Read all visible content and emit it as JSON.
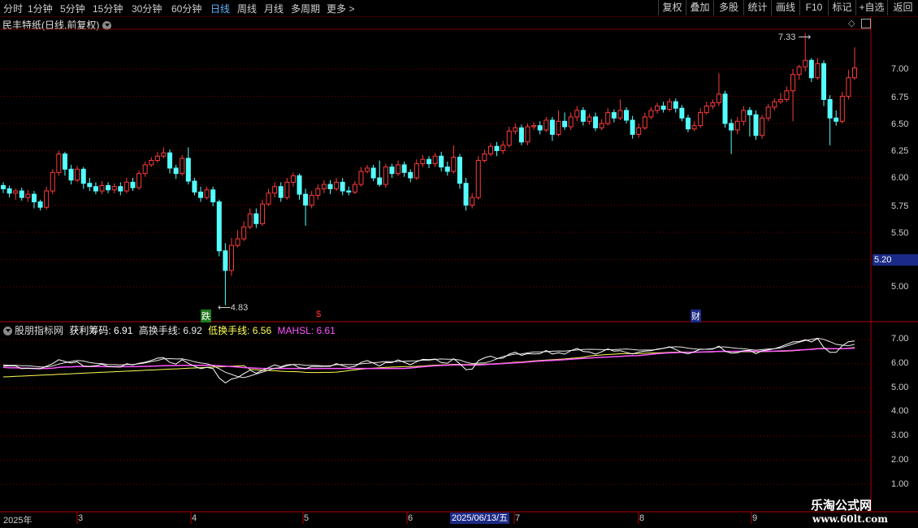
{
  "toolbar": {
    "periods": [
      "分时",
      "1分钟",
      "5分钟",
      "15分钟",
      "30分钟",
      "60分钟",
      "日线",
      "周线",
      "月线",
      "多周期",
      "更多"
    ],
    "active_period": "日线",
    "right_buttons": [
      "复权",
      "叠加",
      "多股",
      "统计",
      "画线",
      "F10",
      "标记",
      "+自选",
      "返回"
    ]
  },
  "chart_title": "民丰特纸(日线,前复权)",
  "main_axis": {
    "ticks": [
      "7.00",
      "6.75",
      "6.50",
      "6.25",
      "6.00",
      "5.75",
      "5.50",
      "5.00"
    ],
    "current_price": "5.20"
  },
  "annotations": {
    "high": "7.33",
    "low": "4.83"
  },
  "markers": [
    "跌",
    "$",
    "财"
  ],
  "indicator": {
    "name": "股朋指标网",
    "profit_label": "获利筹码: 6.91",
    "high_label": "高换手线: 6.92",
    "low_label": "低换手线: 6.56",
    "mahsl_label": "MAHSL: 6.61",
    "ticks": [
      "7.00",
      "6.00",
      "5.00",
      "4.00",
      "3.00",
      "2.00",
      "1.00"
    ]
  },
  "x_axis": {
    "labels": [
      "2025年",
      "3",
      "4",
      "5",
      "6",
      "7",
      "8",
      "9"
    ],
    "cursor_date": "2025/06/13/五"
  },
  "watermark": {
    "title": "乐淘公式网",
    "url": "www.60lt.com"
  },
  "colors": {
    "up": "#ff3b3b",
    "down": "#54ffff",
    "grid": "#7a0000",
    "profit_line": "#ffffff",
    "high_line": "#e8e8e8",
    "low_line": "#ffff55",
    "mahsl_line": "#ff55ff"
  },
  "chart_data": {
    "type": "candlestick",
    "price_axis": {
      "min": 4.75,
      "max": 7.35
    },
    "candles": [
      [
        5.93,
        5.9,
        5.96,
        5.86
      ],
      [
        5.9,
        5.86,
        5.93,
        5.82
      ],
      [
        5.86,
        5.88,
        5.9,
        5.8
      ],
      [
        5.88,
        5.82,
        5.91,
        5.79
      ],
      [
        5.82,
        5.85,
        5.89,
        5.78
      ],
      [
        5.85,
        5.78,
        5.88,
        5.72
      ],
      [
        5.78,
        5.73,
        5.8,
        5.7
      ],
      [
        5.73,
        5.88,
        5.92,
        5.71
      ],
      [
        5.88,
        6.05,
        6.08,
        5.85
      ],
      [
        6.05,
        6.22,
        6.25,
        6.02
      ],
      [
        6.22,
        6.08,
        6.24,
        6.02
      ],
      [
        6.08,
        5.98,
        6.12,
        5.94
      ],
      [
        5.98,
        6.08,
        6.11,
        5.96
      ],
      [
        6.08,
        5.95,
        6.1,
        5.9
      ],
      [
        5.95,
        5.92,
        6.0,
        5.88
      ],
      [
        5.92,
        5.88,
        5.96,
        5.85
      ],
      [
        5.88,
        5.93,
        5.97,
        5.85
      ],
      [
        5.93,
        5.89,
        5.96,
        5.86
      ],
      [
        5.89,
        5.92,
        5.95,
        5.86
      ],
      [
        5.92,
        5.88,
        5.96,
        5.84
      ],
      [
        5.88,
        5.96,
        6.0,
        5.86
      ],
      [
        5.96,
        5.91,
        6.0,
        5.88
      ],
      [
        5.91,
        6.04,
        6.07,
        5.89
      ],
      [
        6.04,
        6.12,
        6.15,
        6.01
      ],
      [
        6.12,
        6.16,
        6.19,
        6.1
      ],
      [
        6.16,
        6.2,
        6.24,
        6.14
      ],
      [
        6.2,
        6.23,
        6.28,
        6.18
      ],
      [
        6.23,
        6.09,
        6.26,
        6.04
      ],
      [
        6.09,
        6.04,
        6.12,
        5.99
      ],
      [
        6.04,
        6.18,
        6.21,
        6.02
      ],
      [
        6.18,
        5.97,
        6.28,
        5.94
      ],
      [
        5.97,
        5.87,
        6.0,
        5.84
      ],
      [
        5.87,
        5.82,
        5.92,
        5.78
      ],
      [
        5.82,
        5.89,
        5.92,
        5.8
      ],
      [
        5.89,
        5.78,
        5.92,
        5.74
      ],
      [
        5.78,
        5.33,
        5.8,
        5.28
      ],
      [
        5.33,
        5.15,
        5.4,
        4.83
      ],
      [
        5.15,
        5.38,
        5.45,
        5.1
      ],
      [
        5.38,
        5.44,
        5.52,
        5.36
      ],
      [
        5.44,
        5.55,
        5.6,
        5.42
      ],
      [
        5.55,
        5.67,
        5.72,
        5.53
      ],
      [
        5.67,
        5.58,
        5.72,
        5.54
      ],
      [
        5.58,
        5.76,
        5.8,
        5.56
      ],
      [
        5.76,
        5.86,
        5.9,
        5.74
      ],
      [
        5.86,
        5.92,
        5.96,
        5.82
      ],
      [
        5.92,
        5.82,
        5.96,
        5.78
      ],
      [
        5.82,
        5.96,
        6.0,
        5.8
      ],
      [
        5.96,
        6.02,
        6.05,
        5.92
      ],
      [
        6.02,
        5.85,
        6.04,
        5.8
      ],
      [
        5.85,
        5.75,
        5.9,
        5.56
      ],
      [
        5.75,
        5.84,
        5.88,
        5.72
      ],
      [
        5.84,
        5.9,
        5.94,
        5.8
      ],
      [
        5.9,
        5.94,
        5.98,
        5.86
      ],
      [
        5.94,
        5.9,
        5.98,
        5.85
      ],
      [
        5.9,
        5.96,
        6.0,
        5.88
      ],
      [
        5.96,
        5.88,
        6.0,
        5.84
      ],
      [
        5.88,
        5.87,
        5.92,
        5.84
      ],
      [
        5.87,
        5.94,
        5.97,
        5.85
      ],
      [
        5.94,
        6.06,
        6.1,
        5.92
      ],
      [
        6.06,
        6.09,
        6.12,
        6.04
      ],
      [
        6.09,
        6.0,
        6.12,
        5.97
      ],
      [
        6.0,
        5.94,
        6.16,
        5.92
      ],
      [
        5.94,
        6.1,
        6.13,
        5.91
      ],
      [
        6.1,
        6.04,
        6.13,
        6.0
      ],
      [
        6.04,
        6.12,
        6.16,
        6.02
      ],
      [
        6.12,
        6.05,
        6.15,
        6.01
      ],
      [
        6.05,
        6.0,
        6.08,
        5.96
      ],
      [
        6.0,
        6.13,
        6.17,
        5.98
      ],
      [
        6.13,
        6.17,
        6.21,
        6.1
      ],
      [
        6.17,
        6.13,
        6.2,
        6.09
      ],
      [
        6.13,
        6.2,
        6.23,
        6.1
      ],
      [
        6.2,
        6.1,
        6.24,
        6.06
      ],
      [
        6.1,
        6.06,
        6.15,
        6.02
      ],
      [
        6.06,
        6.19,
        6.3,
        6.04
      ],
      [
        6.19,
        5.95,
        6.22,
        5.9
      ],
      [
        5.95,
        5.75,
        6.0,
        5.7
      ],
      [
        5.75,
        5.82,
        5.86,
        5.72
      ],
      [
        5.82,
        6.16,
        6.2,
        5.8
      ],
      [
        6.16,
        6.22,
        6.26,
        6.14
      ],
      [
        6.22,
        6.29,
        6.32,
        6.2
      ],
      [
        6.29,
        6.25,
        6.33,
        6.2
      ],
      [
        6.25,
        6.3,
        6.34,
        6.22
      ],
      [
        6.3,
        6.43,
        6.47,
        6.28
      ],
      [
        6.43,
        6.46,
        6.5,
        6.4
      ],
      [
        6.46,
        6.33,
        6.49,
        6.3
      ],
      [
        6.33,
        6.47,
        6.5,
        6.3
      ],
      [
        6.47,
        6.48,
        6.51,
        6.44
      ],
      [
        6.48,
        6.44,
        6.52,
        6.4
      ],
      [
        6.44,
        6.53,
        6.56,
        6.42
      ],
      [
        6.53,
        6.4,
        6.56,
        6.34
      ],
      [
        6.4,
        6.52,
        6.62,
        6.38
      ],
      [
        6.52,
        6.47,
        6.6,
        6.44
      ],
      [
        6.47,
        6.56,
        6.6,
        6.44
      ],
      [
        6.56,
        6.62,
        6.66,
        6.52
      ],
      [
        6.62,
        6.52,
        6.65,
        6.48
      ],
      [
        6.52,
        6.56,
        6.59,
        6.49
      ],
      [
        6.56,
        6.46,
        6.6,
        6.43
      ],
      [
        6.46,
        6.5,
        6.54,
        6.44
      ],
      [
        6.5,
        6.6,
        6.64,
        6.48
      ],
      [
        6.6,
        6.55,
        6.63,
        6.51
      ],
      [
        6.55,
        6.62,
        6.72,
        6.53
      ],
      [
        6.62,
        6.53,
        6.65,
        6.5
      ],
      [
        6.53,
        6.4,
        6.57,
        6.36
      ],
      [
        6.4,
        6.46,
        6.5,
        6.37
      ],
      [
        6.46,
        6.56,
        6.6,
        6.44
      ],
      [
        6.56,
        6.62,
        6.65,
        6.54
      ],
      [
        6.62,
        6.66,
        6.69,
        6.59
      ],
      [
        6.66,
        6.63,
        6.7,
        6.6
      ],
      [
        6.63,
        6.7,
        6.73,
        6.61
      ],
      [
        6.7,
        6.64,
        6.73,
        6.6
      ],
      [
        6.64,
        6.55,
        6.67,
        6.52
      ],
      [
        6.55,
        6.45,
        6.58,
        6.42
      ],
      [
        6.45,
        6.48,
        6.52,
        6.43
      ],
      [
        6.48,
        6.6,
        6.64,
        6.46
      ],
      [
        6.6,
        6.66,
        6.7,
        6.58
      ],
      [
        6.66,
        6.69,
        6.72,
        6.63
      ],
      [
        6.69,
        6.77,
        6.96,
        6.66
      ],
      [
        6.77,
        6.5,
        6.8,
        6.46
      ],
      [
        6.5,
        6.44,
        6.54,
        6.22
      ],
      [
        6.44,
        6.52,
        6.56,
        6.4
      ],
      [
        6.52,
        6.62,
        6.66,
        6.48
      ],
      [
        6.62,
        6.58,
        6.65,
        6.38
      ],
      [
        6.58,
        6.39,
        6.62,
        6.35
      ],
      [
        6.39,
        6.55,
        6.58,
        6.36
      ],
      [
        6.55,
        6.65,
        6.68,
        6.52
      ],
      [
        6.65,
        6.7,
        6.73,
        6.62
      ],
      [
        6.7,
        6.72,
        6.78,
        6.68
      ],
      [
        6.72,
        6.8,
        6.84,
        6.7
      ],
      [
        6.8,
        6.95,
        7.0,
        6.52
      ],
      [
        6.95,
        7.02,
        7.04,
        6.9
      ],
      [
        7.02,
        7.08,
        7.33,
        6.98
      ],
      [
        7.08,
        6.92,
        7.1,
        6.88
      ],
      [
        6.92,
        7.05,
        7.1,
        6.9
      ],
      [
        7.05,
        6.72,
        7.08,
        6.66
      ],
      [
        6.72,
        6.55,
        6.76,
        6.3
      ],
      [
        6.55,
        6.52,
        6.62,
        6.48
      ],
      [
        6.52,
        6.75,
        6.79,
        6.5
      ],
      [
        6.75,
        6.92,
        6.99,
        6.72
      ],
      [
        6.92,
        7.01,
        7.2,
        6.9
      ]
    ],
    "indicator": {
      "y_range": [
        1.0,
        7.0
      ],
      "series": [
        {
          "name": "获利筹码"
        },
        {
          "name": "高换手线"
        },
        {
          "name": "低换手线"
        },
        {
          "name": "MAHSL"
        }
      ]
    }
  }
}
